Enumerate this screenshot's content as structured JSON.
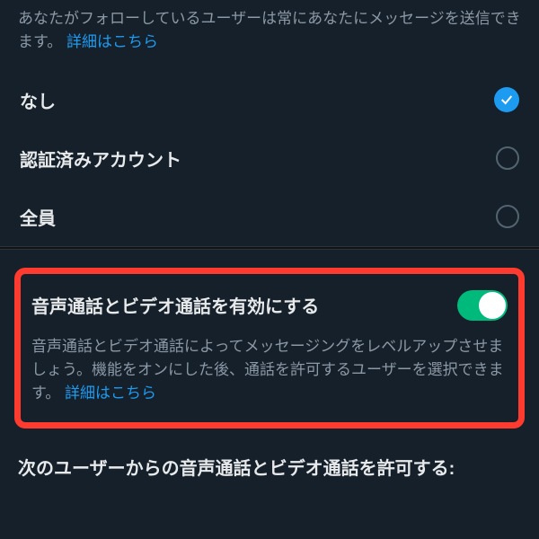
{
  "colors": {
    "background": "#15202b",
    "muted": "#8b98a5",
    "link": "#1d9bf0",
    "toggle_on": "#00ba7c",
    "highlight_border": "#ff3b2f"
  },
  "top_description": {
    "text": "あなたがフォローしているユーザーは常にあなたにメッセージを送信できます。",
    "link": "詳細はこちら"
  },
  "radio_options": {
    "none": {
      "label": "なし",
      "selected": true
    },
    "verified": {
      "label": "認証済みアカウント",
      "selected": false
    },
    "everyone": {
      "label": "全員",
      "selected": false
    }
  },
  "call_toggle": {
    "label": "音声通話とビデオ通話を有効にする",
    "enabled": true,
    "description": "音声通話とビデオ通話によってメッセージングをレベルアップさせましょう。機能をオンにした後、通話を許可するユーザーを選択できます。",
    "link": "詳細はこちら"
  },
  "next_section_heading": "次のユーザーからの音声通話とビデオ通話を許可する:"
}
